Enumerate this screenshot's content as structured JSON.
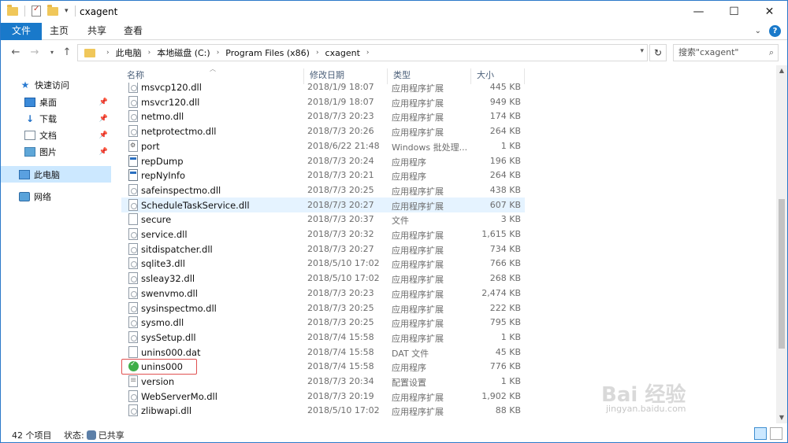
{
  "window": {
    "title": "cxagent",
    "controls": {
      "minimize": "—",
      "maximize": "☐",
      "close": "✕"
    }
  },
  "ribbon": {
    "tabs": [
      "文件",
      "主页",
      "共享",
      "查看"
    ]
  },
  "address": {
    "crumbs": [
      "此电脑",
      "本地磁盘 (C:)",
      "Program Files (x86)",
      "cxagent"
    ],
    "search_placeholder": "搜索\"cxagent\""
  },
  "nav": {
    "items": [
      {
        "label": "快速访问",
        "icon": "star-icon"
      },
      {
        "label": "桌面",
        "icon": "desktop-icon",
        "pinned": true
      },
      {
        "label": "下载",
        "icon": "download-icon",
        "pinned": true
      },
      {
        "label": "文档",
        "icon": "document-icon",
        "pinned": true
      },
      {
        "label": "图片",
        "icon": "picture-icon",
        "pinned": true
      },
      {
        "label": "此电脑",
        "icon": "computer-icon",
        "selected": true
      },
      {
        "label": "网络",
        "icon": "network-icon"
      }
    ]
  },
  "columns": {
    "name": "名称",
    "date": "修改日期",
    "type": "类型",
    "size": "大小"
  },
  "files": [
    {
      "name": "msvcp120.dll",
      "date": "2018/1/9 18:07",
      "type": "应用程序扩展",
      "size": "445 KB",
      "kind": "dll"
    },
    {
      "name": "msvcr120.dll",
      "date": "2018/1/9 18:07",
      "type": "应用程序扩展",
      "size": "949 KB",
      "kind": "dll"
    },
    {
      "name": "netmo.dll",
      "date": "2018/7/3 20:23",
      "type": "应用程序扩展",
      "size": "174 KB",
      "kind": "dll"
    },
    {
      "name": "netprotectmo.dll",
      "date": "2018/7/3 20:26",
      "type": "应用程序扩展",
      "size": "264 KB",
      "kind": "dll"
    },
    {
      "name": "port",
      "date": "2018/6/22 21:48",
      "type": "Windows 批处理...",
      "size": "1 KB",
      "kind": "bat"
    },
    {
      "name": "repDump",
      "date": "2018/7/3 20:24",
      "type": "应用程序",
      "size": "196 KB",
      "kind": "exe"
    },
    {
      "name": "repNyInfo",
      "date": "2018/7/3 20:21",
      "type": "应用程序",
      "size": "264 KB",
      "kind": "exe"
    },
    {
      "name": "safeinspectmo.dll",
      "date": "2018/7/3 20:25",
      "type": "应用程序扩展",
      "size": "438 KB",
      "kind": "dll"
    },
    {
      "name": "ScheduleTaskService.dll",
      "date": "2018/7/3 20:27",
      "type": "应用程序扩展",
      "size": "607 KB",
      "kind": "dll",
      "hover": true
    },
    {
      "name": "secure",
      "date": "2018/7/3 20:37",
      "type": "文件",
      "size": "3 KB",
      "kind": "file"
    },
    {
      "name": "service.dll",
      "date": "2018/7/3 20:32",
      "type": "应用程序扩展",
      "size": "1,615 KB",
      "kind": "dll"
    },
    {
      "name": "sitdispatcher.dll",
      "date": "2018/7/3 20:27",
      "type": "应用程序扩展",
      "size": "734 KB",
      "kind": "dll"
    },
    {
      "name": "sqlite3.dll",
      "date": "2018/5/10 17:02",
      "type": "应用程序扩展",
      "size": "766 KB",
      "kind": "dll"
    },
    {
      "name": "ssleay32.dll",
      "date": "2018/5/10 17:02",
      "type": "应用程序扩展",
      "size": "268 KB",
      "kind": "dll"
    },
    {
      "name": "swenvmo.dll",
      "date": "2018/7/3 20:23",
      "type": "应用程序扩展",
      "size": "2,474 KB",
      "kind": "dll"
    },
    {
      "name": "sysinspectmo.dll",
      "date": "2018/7/3 20:25",
      "type": "应用程序扩展",
      "size": "222 KB",
      "kind": "dll"
    },
    {
      "name": "sysmo.dll",
      "date": "2018/7/3 20:25",
      "type": "应用程序扩展",
      "size": "795 KB",
      "kind": "dll"
    },
    {
      "name": "sysSetup.dll",
      "date": "2018/7/4 15:58",
      "type": "应用程序扩展",
      "size": "1 KB",
      "kind": "dll"
    },
    {
      "name": "unins000.dat",
      "date": "2018/7/4 15:58",
      "type": "DAT 文件",
      "size": "45 KB",
      "kind": "file"
    },
    {
      "name": "unins000",
      "date": "2018/7/4 15:58",
      "type": "应用程序",
      "size": "776 KB",
      "kind": "uninst",
      "boxed": true
    },
    {
      "name": "version",
      "date": "2018/7/3 20:34",
      "type": "配置设置",
      "size": "1 KB",
      "kind": "cfg"
    },
    {
      "name": "WebServerMo.dll",
      "date": "2018/7/3 20:19",
      "type": "应用程序扩展",
      "size": "1,902 KB",
      "kind": "dll"
    },
    {
      "name": "zlibwapi.dll",
      "date": "2018/5/10 17:02",
      "type": "应用程序扩展",
      "size": "88 KB",
      "kind": "dll"
    }
  ],
  "status": {
    "count": "42 个项目",
    "state_label": "状态:",
    "state_value": "已共享"
  },
  "watermark": {
    "brand": "Bai 经验",
    "url": "jingyan.baidu.com"
  }
}
